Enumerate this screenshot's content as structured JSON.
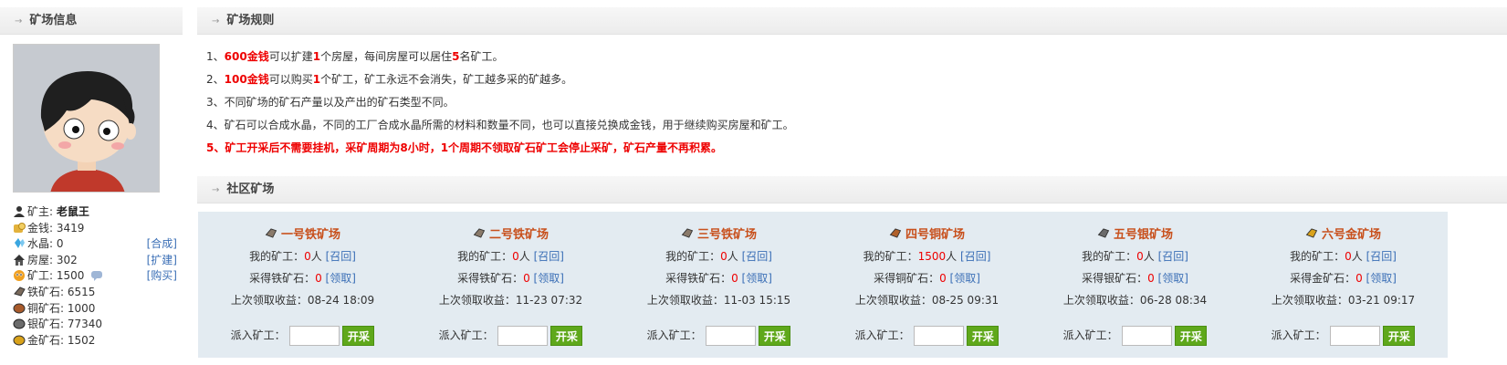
{
  "sidebar": {
    "title": "矿场信息",
    "stats": [
      {
        "icon": "user-icon",
        "label": "矿主: ",
        "value": "老鼠王",
        "link": ""
      },
      {
        "icon": "coins-icon",
        "label": "金钱: ",
        "value": "3419",
        "link": ""
      },
      {
        "icon": "crystal-icon",
        "label": "水晶: ",
        "value": "0",
        "link": "[合成]"
      },
      {
        "icon": "house-icon",
        "label": "房屋: ",
        "value": "302",
        "link": "[扩建]"
      },
      {
        "icon": "miner-icon",
        "label": "矿工: ",
        "value": "1500",
        "link": "[购买]"
      },
      {
        "icon": "iron-ore-icon",
        "label": "铁矿石: ",
        "value": "6515",
        "link": ""
      },
      {
        "icon": "copper-ore-icon",
        "label": "铜矿石: ",
        "value": "1000",
        "link": ""
      },
      {
        "icon": "silver-ore-icon",
        "label": "银矿石: ",
        "value": "77340",
        "link": ""
      },
      {
        "icon": "gold-ore-icon",
        "label": "金矿石: ",
        "value": "1502",
        "link": ""
      }
    ]
  },
  "rules": {
    "title": "矿场规则",
    "r1": {
      "n": "1、",
      "a": "600金钱",
      "b": "可以扩建",
      "c": "1",
      "d": "个房屋，每间房屋可以居住",
      "e": "5",
      "f": "名矿工。"
    },
    "r2": {
      "n": "2、",
      "a": "100金钱",
      "b": "可以购买",
      "c": "1",
      "d": "个矿工，矿工永远不会消失，矿工越多采的矿越多。"
    },
    "r3": "3、不同矿场的矿石产量以及产出的矿石类型不同。",
    "r4": "4、矿石可以合成水晶，不同的工厂合成水晶所需的材料和数量不同，也可以直接兑换成金钱，用于继续购买房屋和矿工。",
    "r5": "5、矿工开采后不需要挂机，采矿周期为8小时，1个周期不领取矿石矿工会停止采矿，矿石产量不再积累。"
  },
  "mines": {
    "title": "社区矿场",
    "my_miners_label": "我的矿工：",
    "unit": "人",
    "recall": "[召回]",
    "claim": "[领取]",
    "last_label": "上次领取收益：",
    "send_label": "派入矿工：",
    "start": "开采",
    "cards": [
      {
        "name": "一号铁矿场",
        "ore_color": "#8a7a6a",
        "miners": "0",
        "ore_label": "采得铁矿石：",
        "ore": "0",
        "last": "08-24 18:09"
      },
      {
        "name": "二号铁矿场",
        "ore_color": "#8a7a6a",
        "miners": "0",
        "ore_label": "采得铁矿石：",
        "ore": "0",
        "last": "11-23 07:32"
      },
      {
        "name": "三号铁矿场",
        "ore_color": "#8a7a6a",
        "miners": "0",
        "ore_label": "采得铁矿石：",
        "ore": "0",
        "last": "11-03 15:15"
      },
      {
        "name": "四号铜矿场",
        "ore_color": "#b0602a",
        "miners": "1500",
        "ore_label": "采得铜矿石：",
        "ore": "0",
        "last": "08-25 09:31"
      },
      {
        "name": "五号银矿场",
        "ore_color": "#6b6b6b",
        "miners": "0",
        "ore_label": "采得银矿石：",
        "ore": "0",
        "last": "06-28 08:34"
      },
      {
        "name": "六号金矿场",
        "ore_color": "#d9a21a",
        "miners": "0",
        "ore_label": "采得金矿石：",
        "ore": "0",
        "last": "03-21 09:17"
      }
    ]
  }
}
